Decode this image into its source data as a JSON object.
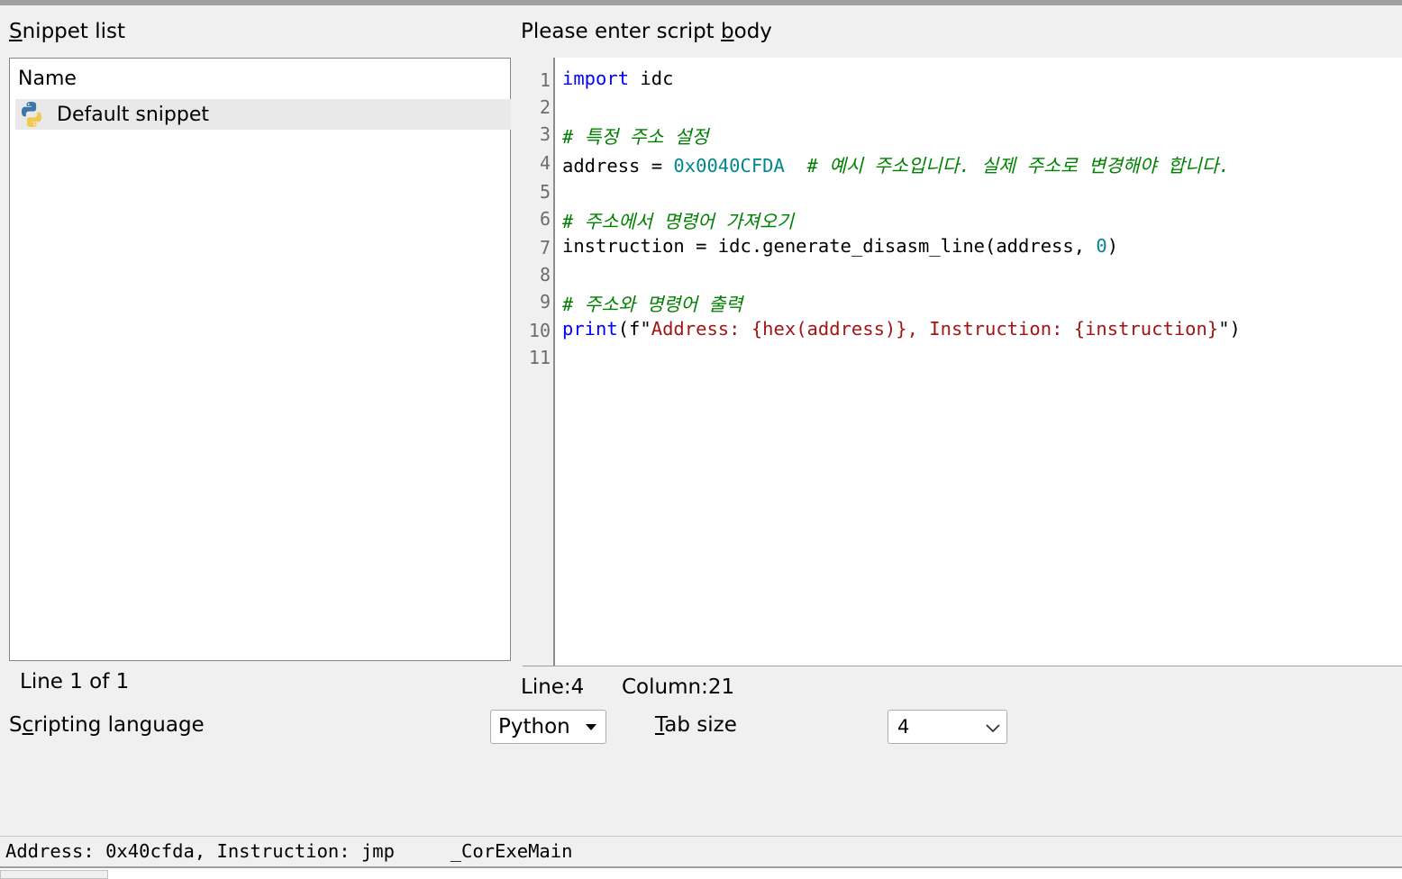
{
  "snippet_list": {
    "title": "Snippet list",
    "column_header": "Name",
    "items": [
      {
        "label": "Default snippet",
        "icon": "python-icon"
      }
    ],
    "status": "Line 1 of 1"
  },
  "editor": {
    "title": "Please enter script body",
    "line_numbers": [
      "1",
      "2",
      "3",
      "4",
      "5",
      "6",
      "7",
      "8",
      "9",
      "10",
      "11"
    ],
    "code": {
      "l1_kw": "import",
      "l1_rest": " idc",
      "l3_comment": "# 특정 주소 설정",
      "l4_a": "address = ",
      "l4_num": "0x0040CFDA",
      "l4_sp": "  ",
      "l4_comment": "# 예시 주소입니다. 실제 주소로 변경해야 합니다.",
      "l6_comment": "# 주소에서 명령어 가져오기",
      "l7_a": "instruction = idc.generate_disasm_line(address, ",
      "l7_num": "0",
      "l7_b": ")",
      "l9_comment": "# 주소와 명령어 출력",
      "l10_kw": "print",
      "l10_a": "(f\"",
      "l10_str": "Address: {hex(address)}, Instruction: {instruction}",
      "l10_b": "\")"
    },
    "cursor_line": "Line:4",
    "cursor_column": "Column:21"
  },
  "options": {
    "scripting_language_label": "Scripting language",
    "scripting_language_value": "Python",
    "tab_size_label": "Tab size",
    "tab_size_value": "4"
  },
  "output": {
    "text": "Address: 0x40cfda, Instruction: jmp     _CorExeMain"
  }
}
